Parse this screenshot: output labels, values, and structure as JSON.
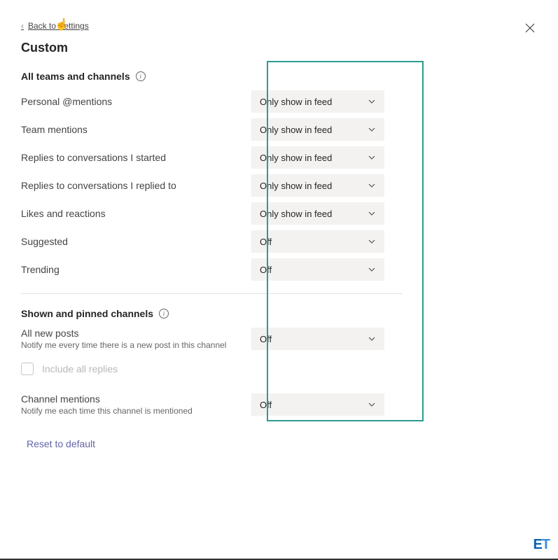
{
  "back_link": "Back to Settings",
  "page_title": "Custom",
  "sections": {
    "all_teams": {
      "title": "All teams and channels",
      "rows": [
        {
          "label": "Personal @mentions",
          "value": "Only show in feed"
        },
        {
          "label": "Team mentions",
          "value": "Only show in feed"
        },
        {
          "label": "Replies to conversations I started",
          "value": "Only show in feed"
        },
        {
          "label": "Replies to conversations I replied to",
          "value": "Only show in feed"
        },
        {
          "label": "Likes and reactions",
          "value": "Only show in feed"
        },
        {
          "label": "Suggested",
          "value": "Off"
        },
        {
          "label": "Trending",
          "value": "Off"
        }
      ]
    },
    "shown_pinned": {
      "title": "Shown and pinned channels",
      "all_new_posts": {
        "label": "All new posts",
        "sublabel": "Notify me every time there is a new post in this channel",
        "value": "Off"
      },
      "include_all_replies": "Include all replies",
      "channel_mentions": {
        "label": "Channel mentions",
        "sublabel": "Notify me each time this channel is mentioned",
        "value": "Off"
      }
    }
  },
  "reset_label": "Reset to default",
  "watermark": {
    "e": "E",
    "t": "T"
  }
}
